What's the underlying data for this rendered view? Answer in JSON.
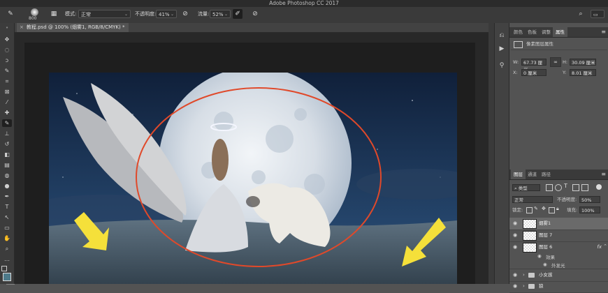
{
  "window": {
    "title": "Adobe Photoshop CC 2017"
  },
  "options_bar": {
    "brush_size": "800",
    "mode_label": "模式:",
    "mode_value": "正常",
    "opacity_label": "不透明度:",
    "opacity_value": "41%",
    "flow_label": "流量:",
    "flow_value": "52%"
  },
  "document": {
    "tab_title": "教程.psd @ 100% (烟雾1, RGB/8/CMYK) *"
  },
  "properties_panel": {
    "tabs": [
      "颜色",
      "色板",
      "调整",
      "属性"
    ],
    "active_tab": "属性",
    "header": "像素图层属性",
    "w_label": "W:",
    "w_value": "67.73 厘米",
    "h_label": "H:",
    "h_value": "30.09 厘米",
    "x_label": "X:",
    "x_value": "0 厘米",
    "y_label": "Y:",
    "y_value": "8.01 厘米"
  },
  "layers_panel": {
    "tabs": [
      "图层",
      "通道",
      "路径"
    ],
    "active_tab": "图层",
    "filter_kind": "类型",
    "blend_mode": "正常",
    "opacity_label": "不透明度:",
    "opacity_value": "50%",
    "lock_label": "锁定:",
    "fill_label": "填充:",
    "fill_value": "100%",
    "layers": [
      {
        "name": "烟雾1",
        "selected": true
      },
      {
        "name": "图层 7",
        "selected": false
      },
      {
        "name": "图层 6",
        "selected": false,
        "fx": "fx"
      }
    ],
    "effects_label": "效果",
    "effect_outer_glow": "外发光",
    "groups": [
      "小女孩",
      "狼"
    ]
  },
  "colors": {
    "ui_dark": "#3a3a3a",
    "panel": "#535353",
    "annotation_ellipse": "#e0492a",
    "annotation_arrow": "#f5e03a",
    "sky": "#1b2f4d"
  }
}
